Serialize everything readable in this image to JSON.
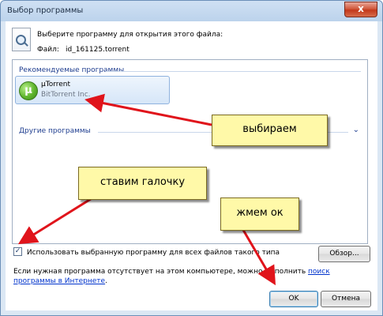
{
  "window": {
    "title": "Выбор программы",
    "close_glyph": "x"
  },
  "header": {
    "prompt": "Выберите программу для открытия этого файла:",
    "file_label": "Файл:",
    "file_name": "id_161125.torrent"
  },
  "recommended": {
    "header": "Рекомендуемые программы",
    "programs": [
      {
        "name": "µTorrent",
        "publisher": "BitTorrent Inc.",
        "icon": "utorrent-icon",
        "icon_glyph": "µ"
      }
    ]
  },
  "other": {
    "header": "Другие программы",
    "chevron": "⌄"
  },
  "checkbox": {
    "label": "Использовать выбранную программу для всех файлов такого типа",
    "checked": true,
    "mark": "✓"
  },
  "buttons": {
    "browse": "Обзор...",
    "ok": "OK",
    "cancel": "Отмена"
  },
  "info": {
    "text": "Если нужная программа отсутствует на этом компьютере, можно выполнить ",
    "link": "поиск программы в Интернете",
    "suffix": "."
  },
  "annotations": {
    "choose": "выбираем",
    "check": "ставим галочку",
    "press_ok": "жмем ок",
    "arrow_color": "#e0141b"
  }
}
